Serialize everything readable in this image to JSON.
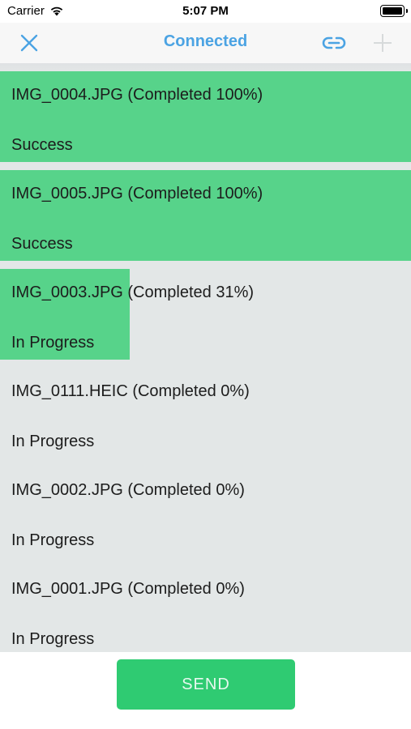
{
  "status_bar": {
    "carrier": "Carrier",
    "time": "5:07 PM",
    "icons": [
      "wifi-icon",
      "battery-icon"
    ]
  },
  "nav": {
    "title": "Connected",
    "left_icon": "close-icon",
    "right_icons": [
      "link-icon",
      "add-icon"
    ],
    "accent_color": "#4ba3e3"
  },
  "transfers": [
    {
      "name": "IMG_0004.JPG (Completed 100%)",
      "status": "Success",
      "progress": 1.0
    },
    {
      "name": "IMG_0005.JPG (Completed 100%)",
      "status": "Success",
      "progress": 1.0
    },
    {
      "name": "IMG_0003.JPG (Completed 31%)",
      "status": "In Progress",
      "progress": 0.31
    },
    {
      "name": "IMG_0111.HEIC (Completed 0%)",
      "status": "In Progress",
      "progress": 0.0
    },
    {
      "name": "IMG_0002.JPG (Completed 0%)",
      "status": "In Progress",
      "progress": 0.0
    },
    {
      "name": "IMG_0001.JPG (Completed 0%)",
      "status": "In Progress",
      "progress": 0.0
    }
  ],
  "colors": {
    "progress_fill": "#57d38a",
    "list_background": "#e3e7e7",
    "send_button": "#2fcb72"
  },
  "send_button": {
    "label": "SEND"
  }
}
